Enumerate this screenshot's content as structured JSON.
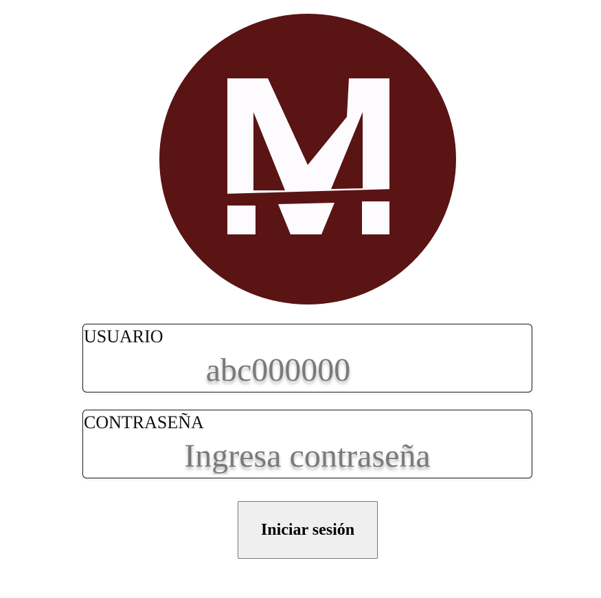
{
  "colors": {
    "logo_background": "#5a1414",
    "logo_letter": "#fdfbfd",
    "placeholder_text": "#7a7a7a",
    "button_background": "#efefef"
  },
  "logo": {
    "letter": "M",
    "icon": "m-logo-icon"
  },
  "form": {
    "username": {
      "label": "USUARIO",
      "placeholder": "abc000000"
    },
    "password": {
      "label": "CONTRASEÑA",
      "placeholder": "Ingresa contraseña"
    },
    "submit_label": "Iniciar sesión"
  }
}
